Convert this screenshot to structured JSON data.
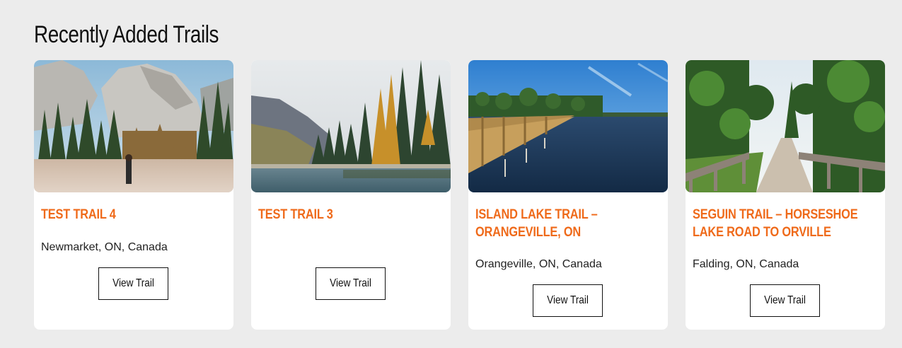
{
  "section": {
    "title": "Recently Added Trails"
  },
  "trails": [
    {
      "title": "TEST TRAIL 4",
      "location": "Newmarket, ON, Canada",
      "button_label": "View Trail",
      "image": "mountain-meadow-with-hiker"
    },
    {
      "title": "TEST TRAIL 3",
      "location": "",
      "button_label": "View Trail",
      "image": "autumn-forest-lake"
    },
    {
      "title": "ISLAND LAKE TRAIL – ORANGEVILLE, ON",
      "location": "Orangeville, ON, Canada",
      "button_label": "View Trail",
      "image": "boardwalk-over-lake"
    },
    {
      "title": "SEGUIN TRAIL – HORSESHOE LAKE ROAD TO ORVILLE",
      "location": "Falding, ON, Canada",
      "button_label": "View Trail",
      "image": "forest-trail-bridge"
    }
  ],
  "colors": {
    "background": "#ececec",
    "card": "#ffffff",
    "accent": "#ef6a1a",
    "text": "#222222"
  }
}
